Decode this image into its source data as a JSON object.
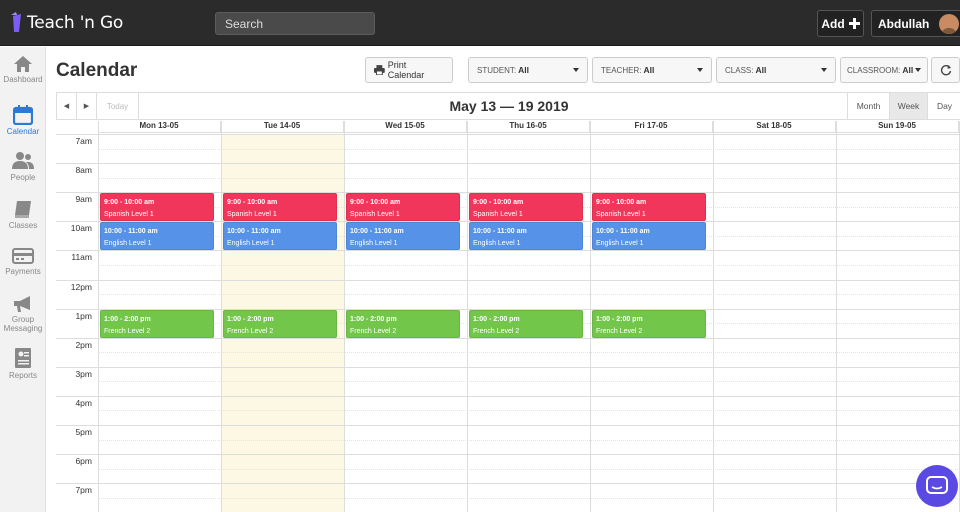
{
  "app": {
    "name": "Teach 'n Go"
  },
  "topbar": {
    "search_label": "Search",
    "add_label": "Add",
    "user_name": "Abdullah"
  },
  "sidebar": {
    "items": [
      {
        "label": "Dashboard",
        "icon": "home-icon",
        "active": false
      },
      {
        "label": "Calendar",
        "icon": "calendar-icon",
        "active": true
      },
      {
        "label": "People",
        "icon": "people-icon",
        "active": false
      },
      {
        "label": "Classes",
        "icon": "book-icon",
        "active": false
      },
      {
        "label": "Payments",
        "icon": "credit-card-icon",
        "active": false
      },
      {
        "label": "Group Messaging",
        "icon": "megaphone-icon",
        "active": false
      },
      {
        "label": "Reports",
        "icon": "report-icon",
        "active": false
      }
    ]
  },
  "page": {
    "title": "Calendar"
  },
  "toolbar": {
    "print_label": "Print Calendar",
    "filters": [
      {
        "label": "STUDENT:",
        "value": "All"
      },
      {
        "label": "TEACHER:",
        "value": "All"
      },
      {
        "label": "CLASS:",
        "value": "All"
      },
      {
        "label": "CLASSROOM:",
        "value": "All"
      }
    ]
  },
  "calendar": {
    "today_label": "Today",
    "date_range": "May 13 — 19 2019",
    "views": [
      "Month",
      "Week",
      "Day"
    ],
    "active_view": "Week",
    "days": [
      "Mon 13-05",
      "Tue 14-05",
      "Wed 15-05",
      "Thu 16-05",
      "Fri 17-05",
      "Sat 18-05",
      "Sun 19-05"
    ],
    "today_index": 1,
    "hours": [
      "7am",
      "8am",
      "9am",
      "10am",
      "11am",
      "12pm",
      "1pm",
      "2pm",
      "3pm",
      "4pm",
      "5pm",
      "6pm",
      "7pm"
    ],
    "events": [
      {
        "day": 0,
        "start": 9,
        "end": 10,
        "time": "9:00 - 10:00 am",
        "title": "Spanish Level 1",
        "color": "#f0365a"
      },
      {
        "day": 1,
        "start": 9,
        "end": 10,
        "time": "9:00 - 10:00 am",
        "title": "Spanish Level 1",
        "color": "#f0365a"
      },
      {
        "day": 2,
        "start": 9,
        "end": 10,
        "time": "9:00 - 10:00 am",
        "title": "Spanish Level 1",
        "color": "#f0365a"
      },
      {
        "day": 3,
        "start": 9,
        "end": 10,
        "time": "9:00 - 10:00 am",
        "title": "Spanish Level 1",
        "color": "#f0365a"
      },
      {
        "day": 4,
        "start": 9,
        "end": 10,
        "time": "9:00 - 10:00 am",
        "title": "Spanish Level 1",
        "color": "#f0365a"
      },
      {
        "day": 0,
        "start": 10,
        "end": 11,
        "time": "10:00 - 11:00 am",
        "title": "English Level 1",
        "color": "#5592e8"
      },
      {
        "day": 1,
        "start": 10,
        "end": 11,
        "time": "10:00 - 11:00 am",
        "title": "English Level 1",
        "color": "#5592e8"
      },
      {
        "day": 2,
        "start": 10,
        "end": 11,
        "time": "10:00 - 11:00 am",
        "title": "English Level 1",
        "color": "#5592e8"
      },
      {
        "day": 3,
        "start": 10,
        "end": 11,
        "time": "10:00 - 11:00 am",
        "title": "English Level 1",
        "color": "#5592e8"
      },
      {
        "day": 4,
        "start": 10,
        "end": 11,
        "time": "10:00 - 11:00 am",
        "title": "English Level 1",
        "color": "#5592e8"
      },
      {
        "day": 0,
        "start": 13,
        "end": 14,
        "time": "1:00 - 2:00 pm",
        "title": "French Level 2",
        "color": "#72c64a"
      },
      {
        "day": 1,
        "start": 13,
        "end": 14,
        "time": "1:00 - 2:00 pm",
        "title": "French Level 2",
        "color": "#72c64a"
      },
      {
        "day": 2,
        "start": 13,
        "end": 14,
        "time": "1:00 - 2:00 pm",
        "title": "French Level 2",
        "color": "#72c64a"
      },
      {
        "day": 3,
        "start": 13,
        "end": 14,
        "time": "1:00 - 2:00 pm",
        "title": "French Level 2",
        "color": "#72c64a"
      },
      {
        "day": 4,
        "start": 13,
        "end": 14,
        "time": "1:00 - 2:00 pm",
        "title": "French Level 2",
        "color": "#72c64a"
      }
    ]
  },
  "colors": {
    "accent": "#2a7bd6",
    "today_bg": "#fcf8e3",
    "chat_button": "#5a4ae3"
  }
}
